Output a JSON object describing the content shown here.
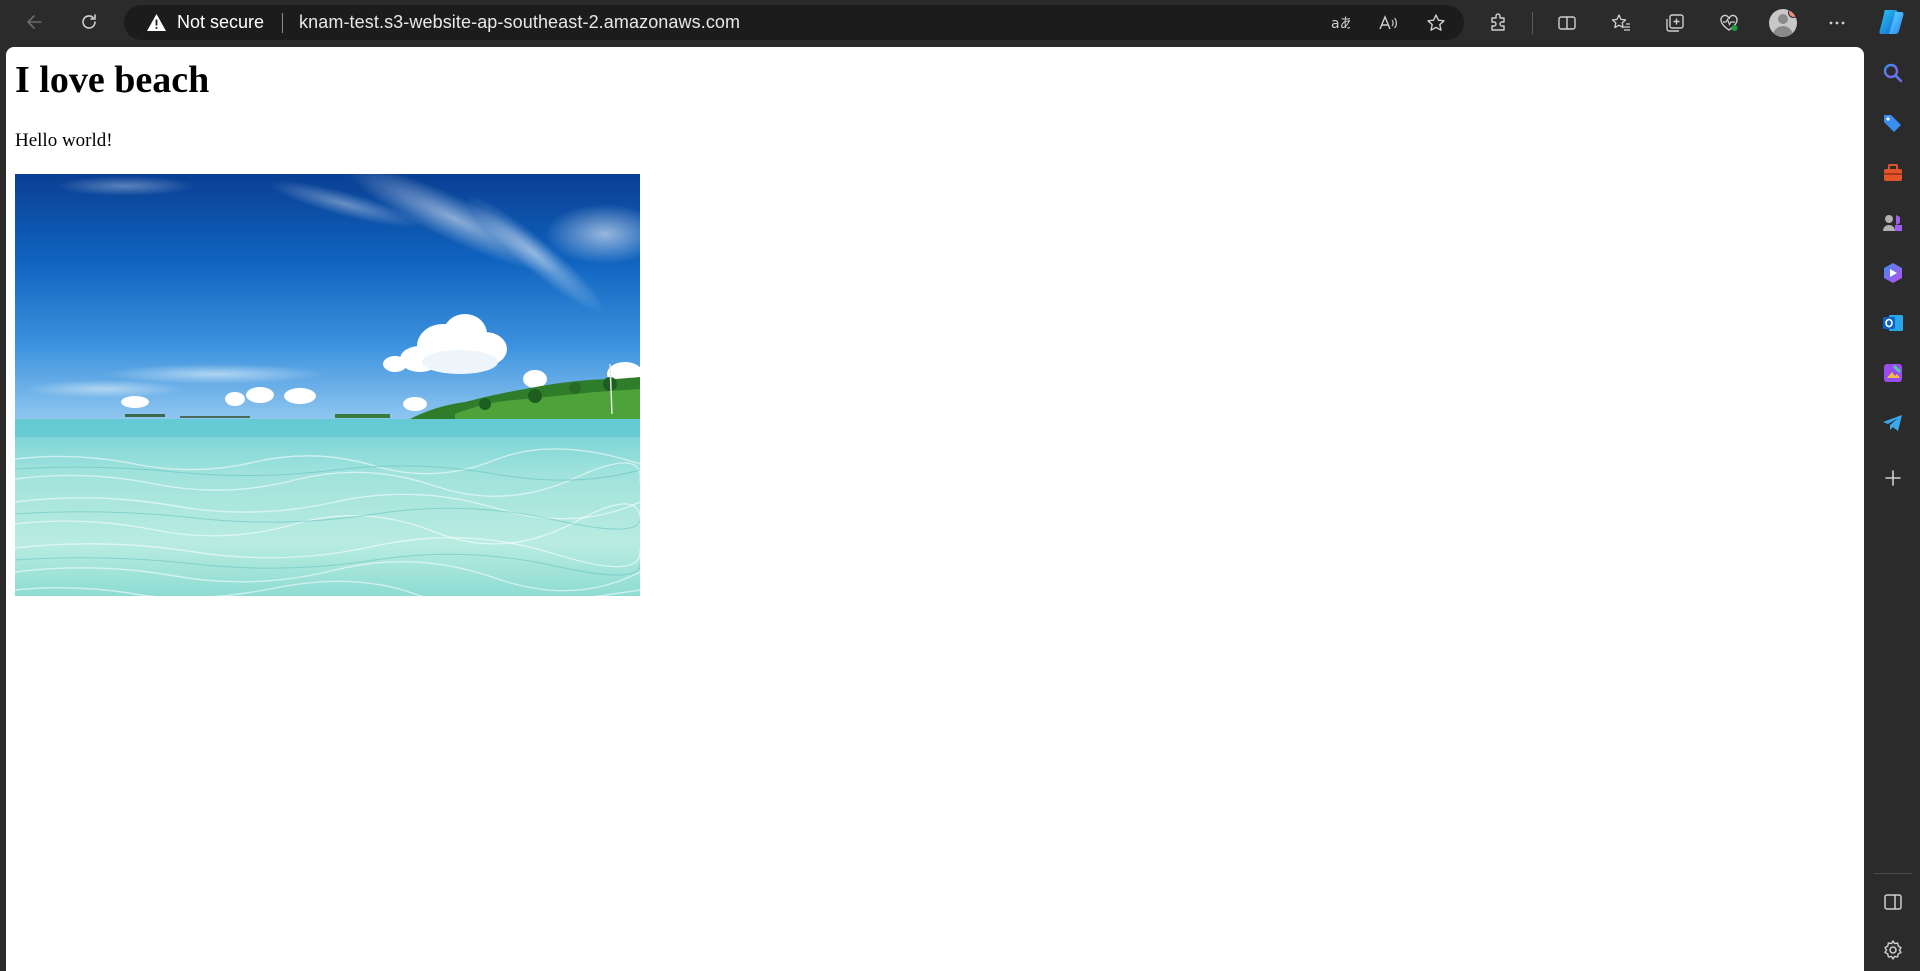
{
  "browser": {
    "security_label": "Not secure",
    "url": "knam-test.s3-website-ap-southeast-2.amazonaws.com",
    "accent": "#0078d4"
  },
  "page": {
    "heading": "I love beach",
    "paragraph": "Hello world!",
    "image": "beach-photo"
  },
  "icons": {
    "toolbar": [
      "back-arrow-icon",
      "refresh-icon",
      "warning-icon",
      "translate-icon",
      "read-aloud-icon",
      "favorite-star-icon",
      "extensions-icon",
      "split-screen-icon",
      "favorites-icon",
      "collections-icon",
      "browser-essentials-icon",
      "profile-avatar",
      "more-options-icon",
      "copilot-icon"
    ],
    "sidebar": [
      "search-icon",
      "shopping-tag-icon",
      "tools-icon",
      "games-icon",
      "copilot-app-icon",
      "outlook-icon",
      "designer-icon",
      "telegram-icon",
      "add-icon",
      "sidebar-toggle-icon",
      "settings-icon"
    ]
  }
}
